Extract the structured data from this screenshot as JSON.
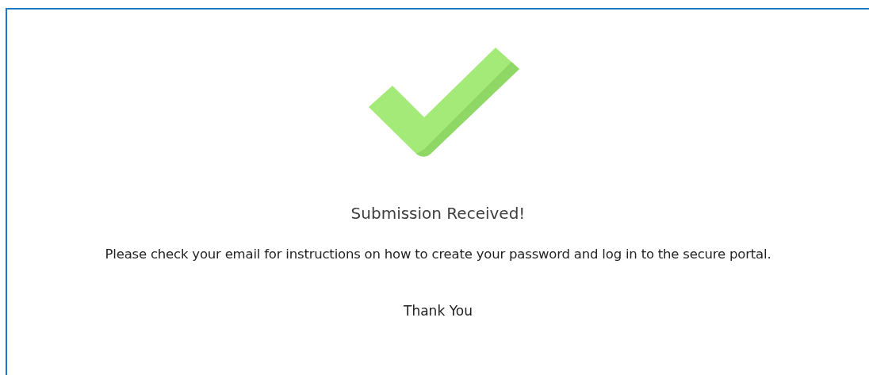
{
  "confirmation": {
    "title": "Submission Received!",
    "message": "Please check your email for instructions on how to create your password and log in to the secure portal.",
    "closing": "Thank You"
  }
}
